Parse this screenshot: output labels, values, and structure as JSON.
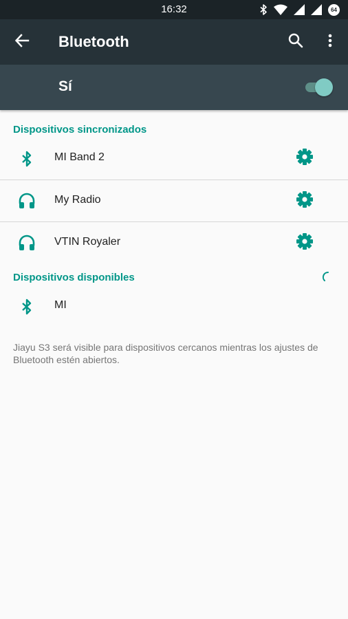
{
  "status_bar": {
    "time": "16:32",
    "battery_level": "64",
    "icons": [
      "bluetooth-icon",
      "wifi-icon",
      "signal-icon",
      "signal-icon",
      "battery-icon"
    ]
  },
  "app_bar": {
    "title": "Bluetooth",
    "icons": [
      "back-arrow-icon",
      "search-icon",
      "more-vert-icon"
    ]
  },
  "master_switch": {
    "label": "Sí",
    "state": "on"
  },
  "paired": {
    "header": "Dispositivos sincronizados",
    "devices": [
      {
        "name": "MI Band 2",
        "icon": "bluetooth-icon"
      },
      {
        "name": "My Radio",
        "icon": "headset-icon"
      },
      {
        "name": "VTIN Royaler",
        "icon": "headset-icon"
      }
    ]
  },
  "available": {
    "header": "Dispositivos disponibles",
    "devices": [
      {
        "name": "MI",
        "icon": "bluetooth-icon"
      }
    ]
  },
  "footer_note": "Jiayu S3 será visible para dispositivos cercanos mientras los ajustes de Bluetooth estén abiertos.",
  "colors": {
    "accent": "#009688",
    "app_bar": "#263238",
    "switch_bar": "#37474f",
    "status_bar": "#1b2327",
    "toggle_thumb": "#80cbc4",
    "background": "#fafafa"
  }
}
